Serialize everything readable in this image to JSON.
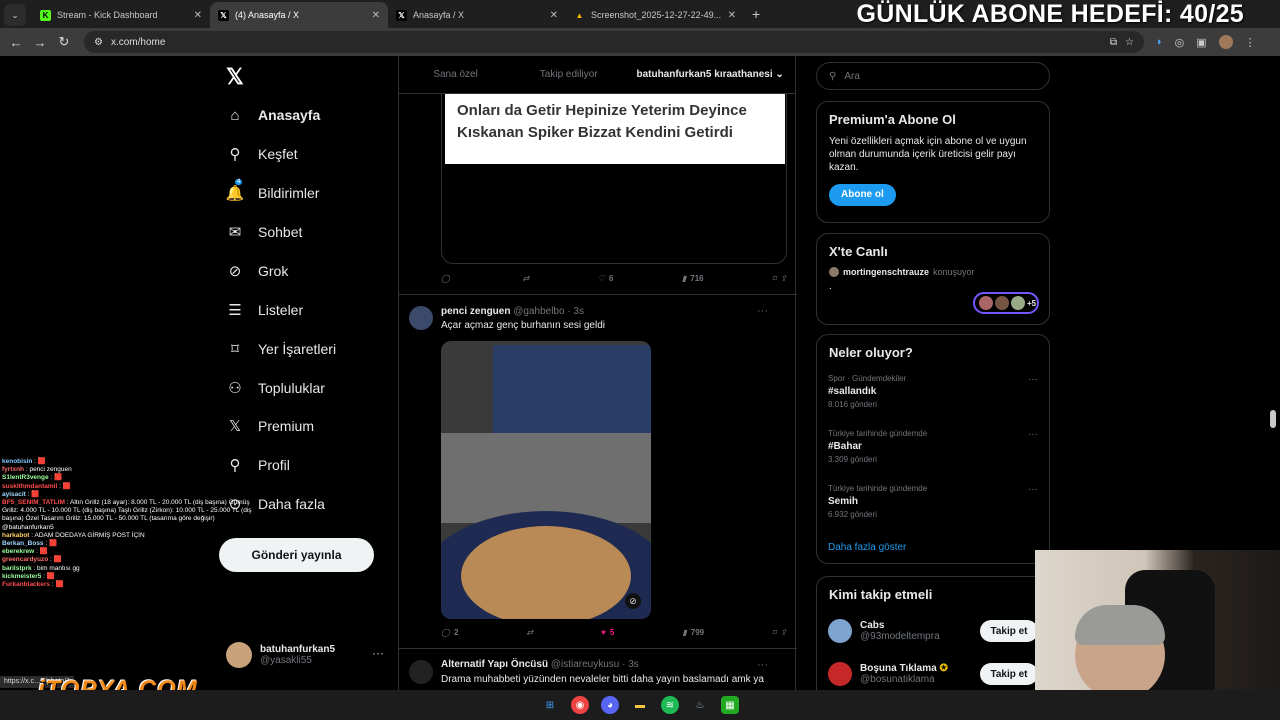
{
  "browser": {
    "tabs": [
      {
        "title": "Stream - Kick Dashboard",
        "fav": "K",
        "fav_color": "#53fc18"
      },
      {
        "title": "(4) Anasayfa / X",
        "fav": "X",
        "fav_color": "#000000"
      },
      {
        "title": "Anasayfa / X",
        "fav": "X",
        "fav_color": "#000000"
      },
      {
        "title": "Screenshot_2025-12-27-22-49...",
        "fav": "▲",
        "fav_color": "#f4b400"
      }
    ],
    "url": "x.com/home",
    "status_url": "https://x.c",
    "status_url_tail": "7/photo/1"
  },
  "overlay": {
    "goal": "GÜNLÜK ABONE HEDEFİ: 40/25",
    "watermark": "iTOPYA.COM"
  },
  "nav": {
    "items": [
      {
        "label": "Anasayfa",
        "icon": "home-icon"
      },
      {
        "label": "Keşfet",
        "icon": "search-icon"
      },
      {
        "label": "Bildirimler",
        "icon": "bell-icon",
        "badge": "4"
      },
      {
        "label": "Sohbet",
        "icon": "mail-icon"
      },
      {
        "label": "Grok",
        "icon": "grok-icon"
      },
      {
        "label": "Listeler",
        "icon": "list-icon"
      },
      {
        "label": "Yer İşaretleri",
        "icon": "bookmark-icon"
      },
      {
        "label": "Topluluklar",
        "icon": "people-icon"
      },
      {
        "label": "Premium",
        "icon": "x-icon"
      },
      {
        "label": "Profil",
        "icon": "person-icon"
      },
      {
        "label": "Daha fazla",
        "icon": "more-circle-icon"
      }
    ],
    "post_button": "Gönderi yayınla",
    "account": {
      "name": "batuhanfurkan5",
      "handle": "@yasakli55"
    }
  },
  "feed": {
    "tabs": [
      "Sana özel",
      "Takip ediliyor",
      "batuhanfurkan5 kıraathanesi"
    ],
    "quote_text": [
      "Onları da Getir Hepinize Yeterim Deyince",
      "Kıskanan Spiker Bizzat Kendini Getirdi"
    ],
    "tweet1_actions": {
      "replies": "",
      "retweets": "",
      "likes": "6",
      "views": "716"
    },
    "tweet2": {
      "name": "penci zenguen",
      "handle": "@gahbelbo · 3s",
      "text": "Açar açmaz genç burhanın sesi geldi",
      "actions": {
        "replies": "2",
        "retweets": "",
        "likes": "5",
        "views": "799"
      }
    },
    "tweet3": {
      "name": "Alternatif Yapı Öncüsü",
      "handle": "@istiareuykusu · 3s",
      "text": "Drama muhabbeti yüzünden nevaleler bitti daha yayın baslamadı amk ya"
    }
  },
  "sidebar": {
    "search_placeholder": "Ara",
    "premium": {
      "title": "Premium'a Abone Ol",
      "text": "Yeni özellikleri açmak için abone ol ve uygun olman durumunda içerik üreticisi gelir payı kazan.",
      "button": "Abone ol"
    },
    "live": {
      "title": "X'te Canlı",
      "host": "mortingenschtrauze",
      "status": "konuşuyor",
      "extra": "+5",
      "dot": "."
    },
    "trends": {
      "title": "Neler oluyor?",
      "items": [
        {
          "category": "Spor · Gündemdekiler",
          "topic": "#sallandık",
          "count": "8.016 gönderi"
        },
        {
          "category": "Türkiye tarihinde gündemde",
          "topic": "#Bahar",
          "count": "3.309 gönderi"
        },
        {
          "category": "Türkiye tarihinde gündemde",
          "topic": "Semih",
          "count": "6.932 gönderi"
        }
      ],
      "show_more": "Daha fazla göster"
    },
    "who": {
      "title": "Kimi takip etmeli",
      "items": [
        {
          "name": "Cabs",
          "handle": "@93modeltempra",
          "button": "Takip et",
          "color": "#7fa3d1"
        },
        {
          "name": "Boşuna Tıklama",
          "handle": "@bosunatiklama",
          "button": "Takip et",
          "color": "#c62828"
        }
      ]
    }
  },
  "chat": [
    {
      "user": "kenobisin",
      "color": "#7ec8ff",
      "msg": "🟥"
    },
    {
      "user": "fyrtxnh",
      "color": "#ff6b6b",
      "msg": "penci zenguen"
    },
    {
      "user": "S1lentR3venge",
      "color": "#9cff9c",
      "msg": "🟥"
    },
    {
      "user": "suskithmdantamil",
      "color": "#ff4d4d",
      "msg": "🟥"
    },
    {
      "user": "ayisacit",
      "color": "#a0d8ff",
      "msg": "🟥"
    },
    {
      "user": "BF5_SENIM_TATLIM",
      "color": "#ff4d4d",
      "msg": "Altın Grillz (18 ayar): 8.000 TL - 20.000 TL (diş başına) Gümüş Grillz: 4.000 TL - 10.000 TL (diş başına) Taşlı Grillz (Zirkon): 10.000 TL - 25.000 TL (diş başına) Özel Tasarım Grillz: 15.000 TL - 50.000 TL (tasarıma göre değişir) @batuhanfurkan5"
    },
    {
      "user": "harkabot",
      "color": "#ffd166",
      "msg": "ADAM DOEDAYA GİRMİŞ POST İÇİN"
    },
    {
      "user": "Berkan_Boss",
      "color": "#a0d8ff",
      "msg": "🟥"
    },
    {
      "user": "eberekrew",
      "color": "#9cff9c",
      "msg": "🟥"
    },
    {
      "user": "greencardyuzo",
      "color": "#ff6b6b",
      "msg": "🟥"
    },
    {
      "user": "barilstprk",
      "color": "#9cff9c",
      "msg": "bim mantısı gg"
    },
    {
      "user": "kickmeister5",
      "color": "#9cff9c",
      "msg": "🟥"
    },
    {
      "user": "Furkanblackers",
      "color": "#ff4d4d",
      "msg": "🟥"
    }
  ]
}
